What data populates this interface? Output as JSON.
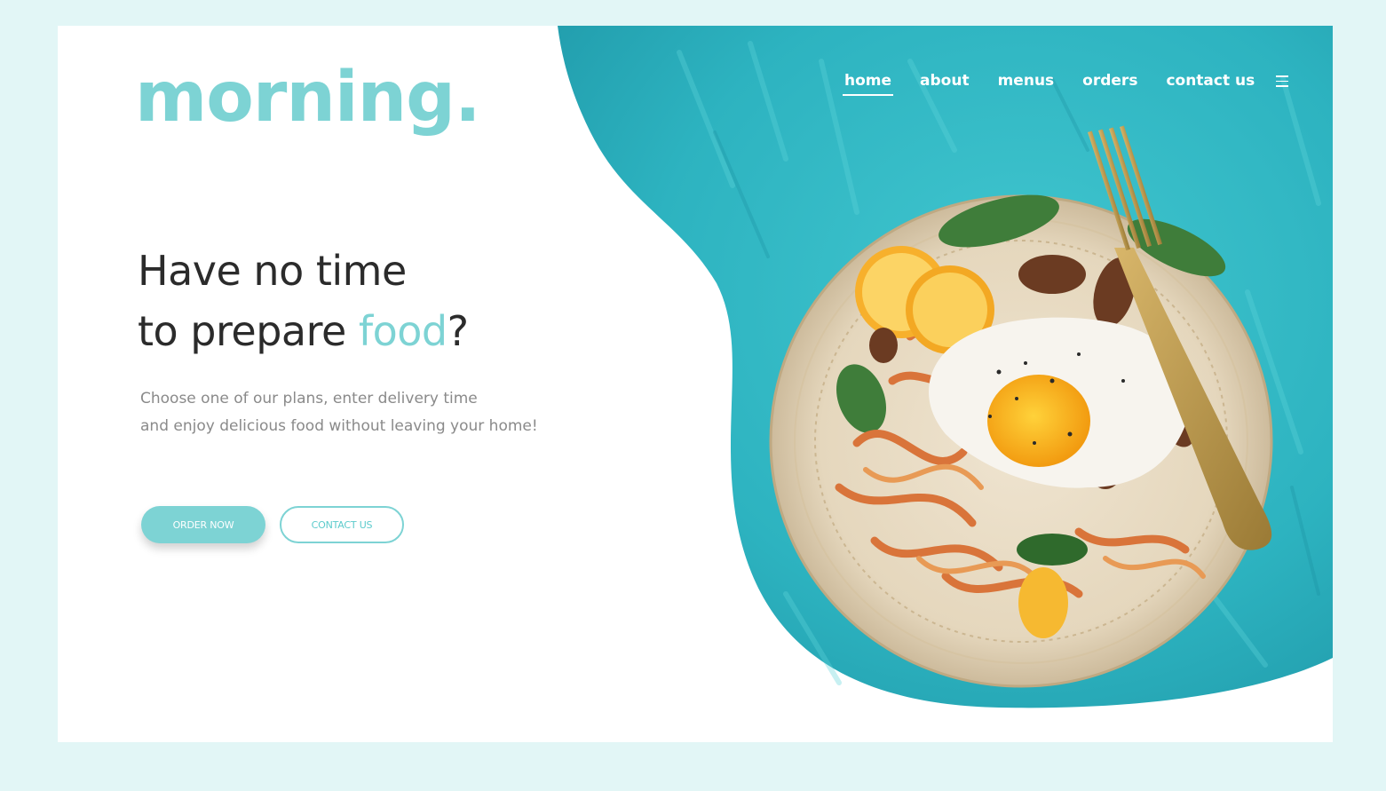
{
  "brand": {
    "logo_text": "morning."
  },
  "nav": {
    "items": [
      {
        "label": "home",
        "active": true
      },
      {
        "label": "about",
        "active": false
      },
      {
        "label": "menus",
        "active": false
      },
      {
        "label": "orders",
        "active": false
      },
      {
        "label": "contact us",
        "active": false
      }
    ],
    "menu_icon": "hamburger-icon"
  },
  "hero": {
    "headline_line1": "Have no time",
    "headline_line2_prefix": "to prepare ",
    "headline_accent": "food",
    "headline_suffix": "?",
    "subtext_line1": "Choose one of our plans, enter delivery time",
    "subtext_line2": "and enjoy delicious food without leaving your home!",
    "primary_button": "ORDER NOW",
    "secondary_button": "CONTACT US"
  },
  "colors": {
    "accent": "#7dd3d4",
    "page_background": "#e2f6f6",
    "teal_backdrop": "#2fb8c4",
    "heading": "#2b2b2b",
    "body_text": "#8a8a8a"
  }
}
